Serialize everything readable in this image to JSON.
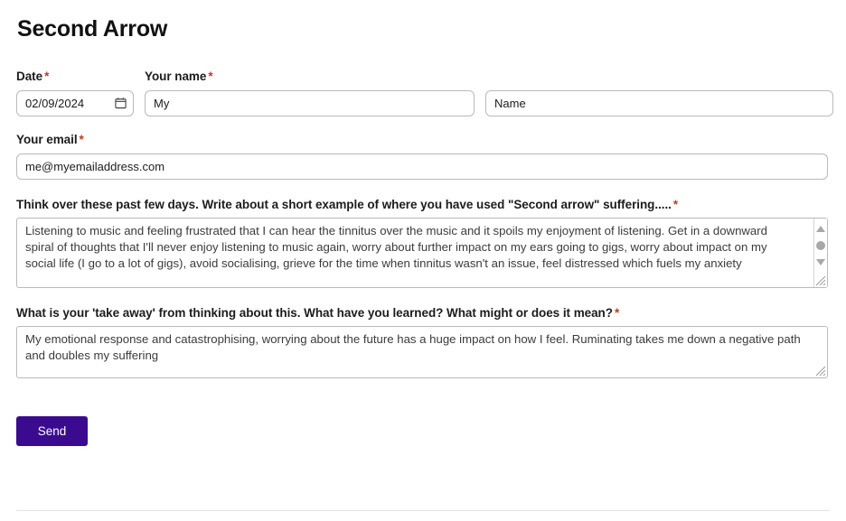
{
  "form": {
    "title": "Second Arrow",
    "required_marker": "*",
    "fields": {
      "date": {
        "label": "Date",
        "value": "02/09/2024",
        "icon": "calendar-icon",
        "required": true
      },
      "first_name": {
        "label": "Your name",
        "value": "My",
        "required": true
      },
      "last_name": {
        "label": "",
        "value": "Name",
        "required": false
      },
      "email": {
        "label": "Your email",
        "value": "me@myemailaddress.com",
        "required": true
      },
      "question_one": {
        "label": "Think over these past few days. Write about a short example of where you have used \"Second arrow\" suffering.....",
        "value": "Listening to music and feeling frustrated that I can hear the tinnitus over the music and it spoils my enjoyment of listening. Get in a downward spiral of thoughts that I'll never enjoy listening to music again, worry about further impact on my ears going to gigs, worry about impact on my social life (I go to a lot of gigs), avoid socialising, grieve for the time when tinnitus wasn't an issue, feel distressed which fuels my anxiety",
        "required": true
      },
      "question_two": {
        "label": "What is your 'take away' from thinking about this. What have you learned? What might or does it mean?",
        "value": "My emotional response and catastrophising, worrying about the future has a huge impact on how I feel. Ruminating takes me down a negative path and doubles my suffering",
        "required": true
      }
    },
    "submit": {
      "label": "Send"
    }
  },
  "colors": {
    "submit_background": "#3a0b8f",
    "required_marker": "#c0392b",
    "input_border": "#b9b9b9",
    "text": "#1a1a1a"
  }
}
